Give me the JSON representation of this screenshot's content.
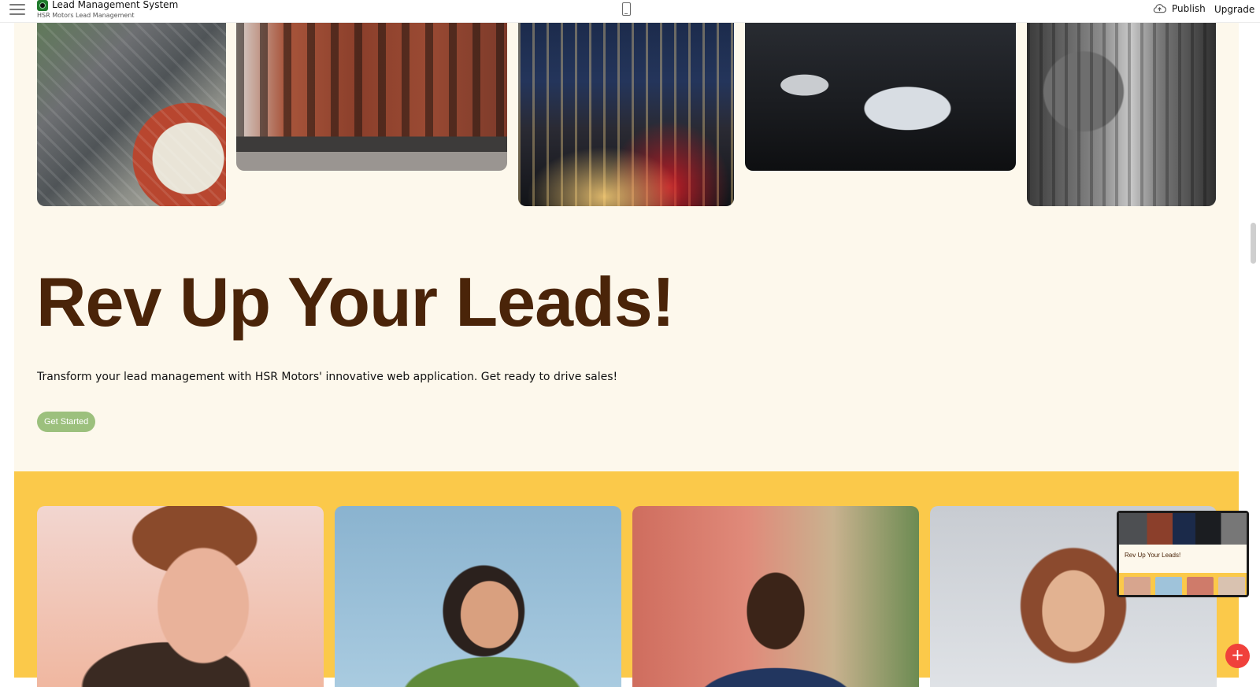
{
  "topbar": {
    "app_title": "Lead Management System",
    "app_subtitle": "HSR Motors Lead Management",
    "publish_label": "Publish",
    "upgrade_label": "Upgrade",
    "icons": {
      "menu": "hamburger-menu-icon",
      "logo": "app-logo-icon",
      "device": "mobile-device-icon",
      "publish": "cloud-upload-icon"
    }
  },
  "gallery": {
    "images": [
      "aerial-intersection-photo",
      "brick-buildings-street-photo",
      "night-city-traffic-photo",
      "white-sports-car-garage-photo",
      "black-white-city-street-photo"
    ]
  },
  "hero": {
    "title": "Rev Up Your Leads!",
    "subtitle": "Transform your lead management with HSR Motors' innovative web application. Get ready to drive sales!",
    "cta_label": "Get Started"
  },
  "team": {
    "portraits": [
      "young-man-portrait",
      "smiling-woman-portrait",
      "man-portrait",
      "woman-portrait"
    ]
  },
  "minimap": {
    "title": "Rev Up Your Leads!"
  },
  "fab": {
    "label": "+"
  },
  "colors": {
    "canvas_bg": "#fdf8ec",
    "title": "#4a2409",
    "cta": "#9cc07d",
    "band": "#fbc94a",
    "fab": "#f0413b"
  }
}
